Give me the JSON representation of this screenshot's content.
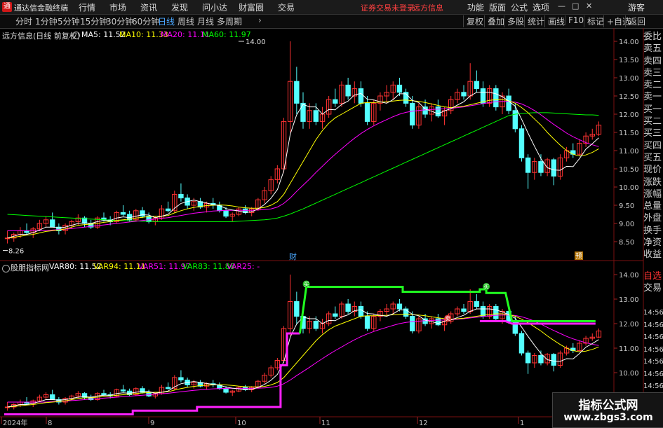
{
  "app": {
    "title": "通达信金融终端",
    "logo": "通"
  },
  "menu": [
    "行情",
    "市场",
    "资讯",
    "发现",
    "问小达",
    "财富圈",
    "交易"
  ],
  "status": {
    "login": "证券交易未登录",
    "news": "远方信息"
  },
  "right_menu": [
    "功能",
    "版面",
    "公式",
    "选项"
  ],
  "guest": "游客",
  "window_controls": [
    "—",
    "□",
    "✕"
  ],
  "timeframes": [
    "分时",
    "1分钟",
    "5分钟",
    "15分钟",
    "30分钟",
    "60分钟",
    "日线",
    "周线",
    "月线",
    "多周期"
  ],
  "active_timeframe": "日线",
  "more_arrow": "›",
  "toolbar_buttons": [
    "复权",
    "叠加",
    "多股",
    "统计",
    "画线",
    "F10",
    "标记",
    "+自选",
    "返回"
  ],
  "main_panel": {
    "stock": "远方信息(日线 前复权)",
    "legend": [
      {
        "text": "MA5: 11.52",
        "color": "#ffffff"
      },
      {
        "text": "MA10: 11.33",
        "color": "#ffff00"
      },
      {
        "text": "MA20: 11.11",
        "color": "#ff00ff"
      },
      {
        "text": "MA60: 11.97",
        "color": "#00ff00"
      }
    ],
    "high_label": "14.00",
    "low_label": "8.26",
    "event_labels": [
      "财",
      "预"
    ],
    "yticks": [
      "14.00",
      "13.50",
      "13.00",
      "12.50",
      "12.00",
      "11.50",
      "11.00",
      "10.50",
      "10.00",
      "9.50",
      "9.00",
      "8.50"
    ]
  },
  "sub_panel": {
    "name": "股朋指标网",
    "legend": [
      {
        "text": "VAR80: 11.52",
        "color": "#ffffff"
      },
      {
        "text": "VAR94: 11.11",
        "color": "#ffff00"
      },
      {
        "text": "VAR51: 11.97",
        "color": "#ff00ff"
      },
      {
        "text": "VAR83: 11.86",
        "color": "#00ff00"
      },
      {
        "text": "VAR25: -",
        "color": "#ff00ff"
      }
    ],
    "signals": [
      "买",
      "卖",
      "买"
    ],
    "yticks": [
      "14.00",
      "13.00",
      "12.00",
      "11.00",
      "10.00"
    ]
  },
  "xaxis": [
    "2024年",
    "8",
    "9",
    "10",
    "11",
    "12",
    "1"
  ],
  "right_panel": {
    "quote_labels": [
      "委比",
      "卖五",
      "卖四",
      "卖三",
      "卖二",
      "卖一",
      "买一",
      "买二",
      "买三",
      "买四",
      "买五",
      "现价",
      "涨跌",
      "涨幅",
      "总量",
      "外盘",
      "换手",
      "净资",
      "收益"
    ],
    "bottom_labels": [
      "自选",
      "交易"
    ],
    "times": [
      "14:56",
      "14:56",
      "14:56",
      "14:56",
      "14:56",
      "14:56",
      "14:56",
      "14:56",
      "14:56"
    ]
  },
  "watermark": {
    "line1": "指标公式网",
    "line2": "www.zbgs3.com"
  },
  "chart_data": {
    "type": "candlestick",
    "title": "远方信息(日线 前复权)",
    "ylim": [
      8.2,
      14.3
    ],
    "ohlc": [
      [
        8.6,
        8.8,
        8.45,
        8.6
      ],
      [
        8.6,
        8.75,
        8.5,
        8.7
      ],
      [
        8.7,
        8.9,
        8.6,
        8.8
      ],
      [
        8.8,
        9.0,
        8.7,
        8.75
      ],
      [
        8.75,
        8.9,
        8.6,
        8.85
      ],
      [
        8.85,
        9.1,
        8.8,
        9.0
      ],
      [
        9.0,
        9.2,
        8.9,
        9.1
      ],
      [
        9.1,
        9.3,
        9.0,
        8.9
      ],
      [
        8.9,
        9.0,
        8.7,
        8.8
      ],
      [
        8.8,
        9.0,
        8.7,
        8.95
      ],
      [
        8.95,
        9.1,
        8.85,
        9.05
      ],
      [
        9.05,
        9.25,
        8.95,
        9.15
      ],
      [
        9.15,
        9.2,
        8.9,
        9.0
      ],
      [
        9.0,
        9.1,
        8.85,
        8.9
      ],
      [
        8.9,
        9.2,
        8.85,
        9.15
      ],
      [
        9.15,
        9.3,
        9.05,
        9.1
      ],
      [
        9.1,
        9.2,
        8.95,
        9.05
      ],
      [
        9.05,
        9.35,
        9.0,
        9.3
      ],
      [
        9.3,
        9.5,
        9.2,
        9.25
      ],
      [
        9.25,
        9.35,
        9.05,
        9.1
      ],
      [
        9.1,
        9.4,
        9.05,
        9.35
      ],
      [
        9.35,
        9.45,
        9.15,
        9.2
      ],
      [
        9.2,
        9.3,
        9.0,
        9.05
      ],
      [
        9.05,
        9.2,
        8.95,
        9.15
      ],
      [
        9.15,
        9.5,
        9.1,
        9.4
      ],
      [
        9.4,
        9.6,
        9.3,
        9.35
      ],
      [
        9.35,
        9.9,
        9.3,
        9.8
      ],
      [
        9.8,
        10.1,
        9.6,
        9.7
      ],
      [
        9.7,
        9.8,
        9.4,
        9.5
      ],
      [
        9.5,
        9.7,
        9.35,
        9.6
      ],
      [
        9.6,
        9.7,
        9.4,
        9.45
      ],
      [
        9.45,
        9.6,
        9.3,
        9.55
      ],
      [
        9.55,
        9.7,
        9.4,
        9.5
      ],
      [
        9.5,
        9.6,
        9.3,
        9.35
      ],
      [
        9.35,
        9.45,
        9.15,
        9.2
      ],
      [
        9.2,
        9.3,
        9.05,
        9.25
      ],
      [
        9.25,
        9.45,
        9.2,
        9.4
      ],
      [
        9.4,
        9.5,
        9.25,
        9.3
      ],
      [
        9.3,
        9.45,
        9.2,
        9.4
      ],
      [
        9.4,
        9.7,
        9.35,
        9.65
      ],
      [
        9.65,
        10.0,
        9.55,
        9.9
      ],
      [
        9.9,
        10.3,
        9.8,
        10.2
      ],
      [
        10.2,
        10.6,
        10.1,
        10.5
      ],
      [
        10.5,
        11.9,
        10.4,
        11.8
      ],
      [
        11.8,
        14.0,
        11.5,
        12.9
      ],
      [
        12.9,
        13.3,
        12.0,
        12.3
      ],
      [
        12.3,
        12.6,
        11.6,
        11.8
      ],
      [
        11.8,
        12.3,
        11.6,
        12.1
      ],
      [
        12.1,
        12.3,
        11.7,
        11.8
      ],
      [
        11.8,
        12.2,
        11.6,
        12.0
      ],
      [
        12.0,
        12.5,
        11.9,
        12.4
      ],
      [
        12.4,
        12.7,
        12.2,
        12.3
      ],
      [
        12.3,
        12.9,
        12.2,
        12.8
      ],
      [
        12.8,
        13.0,
        12.4,
        12.5
      ],
      [
        12.5,
        12.9,
        12.3,
        12.7
      ],
      [
        12.7,
        12.9,
        12.2,
        12.3
      ],
      [
        12.3,
        12.5,
        11.7,
        11.8
      ],
      [
        11.8,
        12.4,
        11.7,
        12.3
      ],
      [
        12.3,
        12.6,
        12.1,
        12.5
      ],
      [
        12.5,
        12.8,
        12.3,
        12.6
      ],
      [
        12.6,
        12.9,
        12.4,
        12.8
      ],
      [
        12.8,
        13.0,
        12.5,
        12.6
      ],
      [
        12.6,
        12.7,
        12.2,
        12.3
      ],
      [
        12.3,
        12.5,
        11.6,
        11.7
      ],
      [
        11.7,
        12.3,
        11.6,
        12.2
      ],
      [
        12.2,
        12.4,
        11.9,
        12.0
      ],
      [
        12.0,
        12.3,
        11.8,
        12.2
      ],
      [
        12.2,
        12.4,
        11.9,
        11.95
      ],
      [
        11.95,
        12.2,
        11.7,
        12.1
      ],
      [
        12.1,
        12.5,
        12.0,
        12.4
      ],
      [
        12.4,
        12.7,
        12.3,
        12.6
      ],
      [
        12.6,
        12.8,
        12.4,
        12.5
      ],
      [
        12.5,
        13.4,
        12.4,
        12.9
      ],
      [
        12.9,
        13.2,
        12.6,
        12.7
      ],
      [
        12.7,
        12.9,
        12.2,
        12.3
      ],
      [
        12.3,
        12.8,
        12.2,
        12.7
      ],
      [
        12.7,
        12.8,
        12.1,
        12.2
      ],
      [
        12.2,
        12.6,
        12.0,
        12.5
      ],
      [
        12.5,
        12.7,
        12.0,
        12.1
      ],
      [
        12.1,
        12.3,
        11.5,
        11.6
      ],
      [
        11.6,
        11.7,
        10.7,
        10.8
      ],
      [
        10.8,
        10.9,
        9.95,
        10.4
      ],
      [
        10.4,
        10.8,
        10.2,
        10.7
      ],
      [
        10.7,
        10.9,
        10.3,
        10.4
      ],
      [
        10.4,
        10.8,
        10.3,
        10.75
      ],
      [
        10.75,
        10.8,
        10.05,
        10.3
      ],
      [
        10.3,
        10.9,
        10.2,
        10.8
      ],
      [
        10.8,
        11.1,
        10.7,
        11.0
      ],
      [
        11.0,
        11.2,
        10.8,
        10.9
      ],
      [
        10.9,
        11.3,
        10.85,
        11.2
      ],
      [
        11.2,
        11.5,
        11.1,
        11.4
      ],
      [
        11.4,
        11.6,
        11.3,
        11.45
      ],
      [
        11.45,
        11.8,
        11.4,
        11.7
      ]
    ],
    "ma5": [
      8.6,
      8.65,
      8.7,
      8.7,
      8.75,
      8.82,
      8.9,
      8.9,
      8.88,
      8.9,
      8.95,
      9.0,
      9.02,
      9.0,
      9.05,
      9.08,
      9.08,
      9.15,
      9.18,
      9.16,
      9.2,
      9.24,
      9.23,
      9.16,
      9.2,
      9.25,
      9.42,
      9.55,
      9.6,
      9.64,
      9.6,
      9.56,
      9.52,
      9.49,
      9.41,
      9.37,
      9.34,
      9.3,
      9.32,
      9.4,
      9.52,
      9.69,
      9.93,
      10.44,
      11.45,
      11.98,
      12.27,
      12.2,
      12.2,
      12.0,
      12.13,
      12.12,
      12.27,
      12.36,
      12.53,
      12.57,
      12.41,
      12.39,
      12.34,
      12.3,
      12.4,
      12.56,
      12.56,
      12.38,
      12.32,
      12.14,
      12.08,
      12.01,
      12.09,
      12.15,
      12.25,
      12.34,
      12.5,
      12.6,
      12.6,
      12.6,
      12.56,
      12.48,
      12.36,
      12.22,
      11.86,
      11.48,
      11.12,
      10.78,
      10.53,
      10.47,
      10.46,
      10.57,
      10.56,
      10.78,
      11.04,
      11.19,
      11.35
    ],
    "ma10": [
      8.6,
      8.62,
      8.65,
      8.68,
      8.7,
      8.74,
      8.78,
      8.8,
      8.82,
      8.85,
      8.9,
      8.95,
      8.97,
      8.98,
      9.0,
      9.03,
      9.05,
      9.08,
      9.1,
      9.12,
      9.15,
      9.17,
      9.19,
      9.2,
      9.2,
      9.22,
      9.29,
      9.35,
      9.4,
      9.44,
      9.47,
      9.49,
      9.5,
      9.51,
      9.5,
      9.48,
      9.45,
      9.43,
      9.42,
      9.42,
      9.44,
      9.5,
      9.6,
      9.8,
      10.1,
      10.4,
      10.7,
      11.0,
      11.3,
      11.55,
      11.75,
      11.9,
      12.0,
      12.1,
      12.2,
      12.3,
      12.32,
      12.32,
      12.33,
      12.34,
      12.36,
      12.38,
      12.39,
      12.37,
      12.35,
      12.32,
      12.28,
      12.24,
      12.2,
      12.18,
      12.2,
      12.22,
      12.26,
      12.3,
      12.34,
      12.38,
      12.4,
      12.4,
      12.37,
      12.3,
      12.18,
      12.04,
      11.87,
      11.7,
      11.5,
      11.32,
      11.15,
      11.0,
      10.9,
      10.85,
      10.88,
      10.95,
      11.05
    ],
    "ma20": [
      8.8,
      8.8,
      8.8,
      8.8,
      8.8,
      8.8,
      8.8,
      8.82,
      8.83,
      8.84,
      8.86,
      8.88,
      8.9,
      8.92,
      8.94,
      8.96,
      8.98,
      9.0,
      9.02,
      9.04,
      9.06,
      9.08,
      9.1,
      9.12,
      9.14,
      9.16,
      9.19,
      9.22,
      9.25,
      9.28,
      9.3,
      9.32,
      9.34,
      9.35,
      9.36,
      9.36,
      9.36,
      9.36,
      9.36,
      9.37,
      9.38,
      9.4,
      9.45,
      9.55,
      9.7,
      9.88,
      10.05,
      10.22,
      10.4,
      10.57,
      10.74,
      10.9,
      11.05,
      11.2,
      11.34,
      11.47,
      11.58,
      11.68,
      11.77,
      11.85,
      11.93,
      12.0,
      12.05,
      12.08,
      12.1,
      12.12,
      12.13,
      12.14,
      12.15,
      12.16,
      12.18,
      12.2,
      12.23,
      12.26,
      12.29,
      12.32,
      12.34,
      12.35,
      12.35,
      12.33,
      12.28,
      12.2,
      12.1,
      11.98,
      11.85,
      11.72,
      11.6,
      11.48,
      11.38,
      11.3,
      11.22,
      11.16,
      11.11
    ],
    "ma60": [
      9.25,
      9.24,
      9.23,
      9.22,
      9.21,
      9.2,
      9.19,
      9.18,
      9.17,
      9.16,
      9.15,
      9.14,
      9.13,
      9.12,
      9.11,
      9.1,
      9.09,
      9.08,
      9.08,
      9.07,
      9.07,
      9.06,
      9.06,
      9.05,
      9.05,
      9.05,
      9.05,
      9.05,
      9.05,
      9.05,
      9.05,
      9.05,
      9.05,
      9.05,
      9.05,
      9.05,
      9.06,
      9.07,
      9.08,
      9.09,
      9.1,
      9.12,
      9.15,
      9.2,
      9.26,
      9.33,
      9.4,
      9.48,
      9.56,
      9.64,
      9.72,
      9.8,
      9.88,
      9.96,
      10.04,
      10.12,
      10.2,
      10.28,
      10.36,
      10.44,
      10.52,
      10.6,
      10.68,
      10.76,
      10.84,
      10.92,
      11.0,
      11.08,
      11.16,
      11.24,
      11.32,
      11.4,
      11.48,
      11.56,
      11.64,
      11.72,
      11.8,
      11.88,
      11.96,
      12.0,
      12.02,
      12.03,
      12.04,
      12.04,
      12.04,
      12.03,
      12.02,
      12.01,
      12.0,
      11.99,
      11.98,
      11.98,
      11.97
    ],
    "stair": [
      [
        0,
        8.3
      ],
      [
        20,
        8.3
      ],
      [
        20,
        8.45
      ],
      [
        30,
        8.45
      ],
      [
        30,
        8.6
      ],
      [
        43,
        8.6
      ],
      [
        43,
        10.3
      ],
      [
        44,
        10.3
      ],
      [
        44,
        11.6
      ],
      [
        46,
        11.6
      ],
      [
        47,
        13.5
      ],
      [
        62,
        13.5
      ],
      [
        62,
        13.3
      ],
      [
        74,
        13.3
      ],
      [
        74,
        13.4
      ],
      [
        75,
        13.4
      ],
      [
        75,
        13.25
      ],
      [
        78,
        13.25
      ],
      [
        79,
        12.1
      ],
      [
        92,
        12.1
      ]
    ],
    "stair2": [
      [
        74,
        12.1
      ],
      [
        78,
        12.1
      ],
      [
        79,
        12.0
      ],
      [
        92,
        12.0
      ]
    ]
  }
}
